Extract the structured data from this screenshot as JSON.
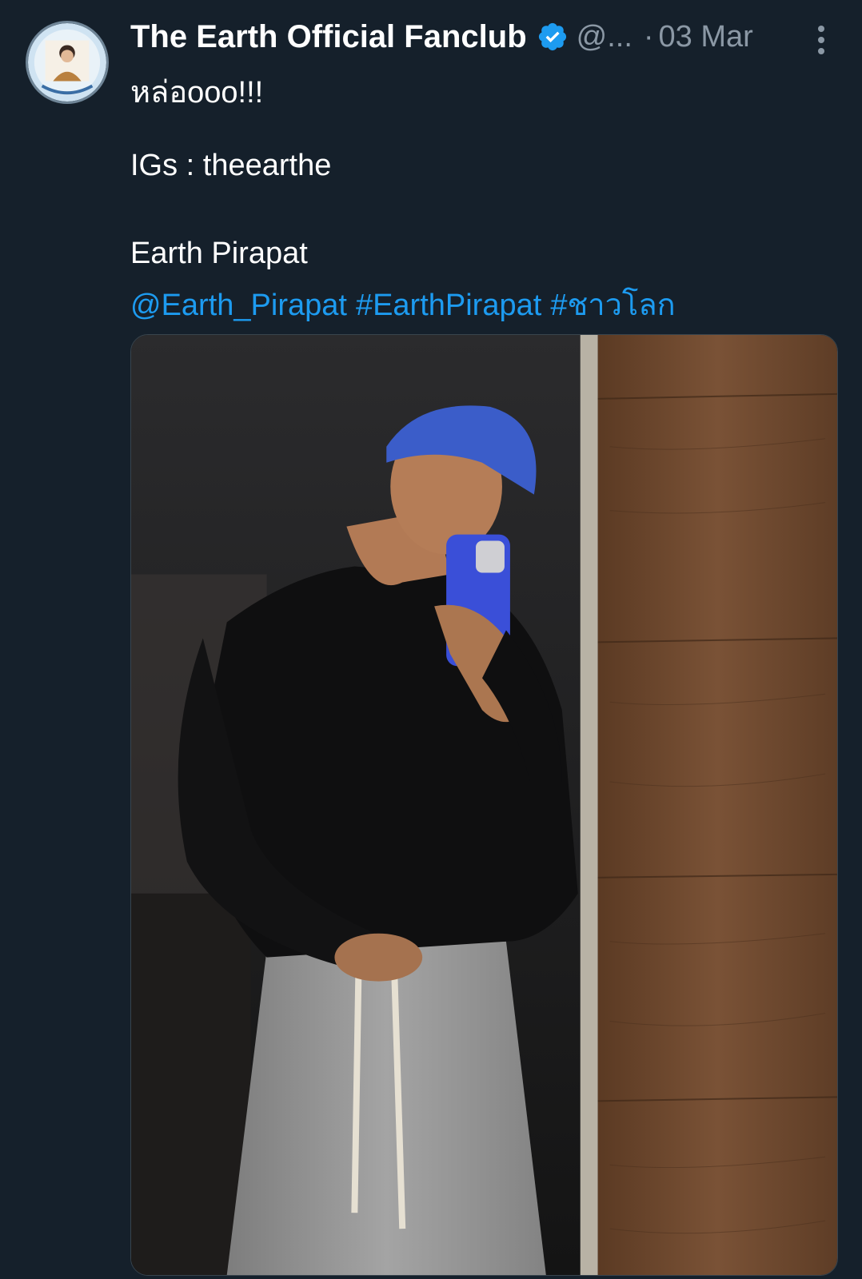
{
  "author": {
    "display_name": "The Earth Official Fanclub",
    "verified": true,
    "handle": "@...",
    "separator": "·",
    "timestamp": "03 Mar"
  },
  "tweet": {
    "line1": "หล่อooo!!!",
    "line2": "IGs : theearthe",
    "line3": "Earth Pirapat",
    "mention": "@Earth_Pirapat",
    "hashtags": [
      "#EarthPirapat",
      "#ชาวโลก"
    ]
  },
  "icons": {
    "verified": "verified-badge-icon",
    "more": "more-options-icon"
  },
  "colors": {
    "background": "#15202b",
    "link": "#1d9bf0",
    "secondary_text": "#8b98a5",
    "verified": "#1d9bf0"
  }
}
